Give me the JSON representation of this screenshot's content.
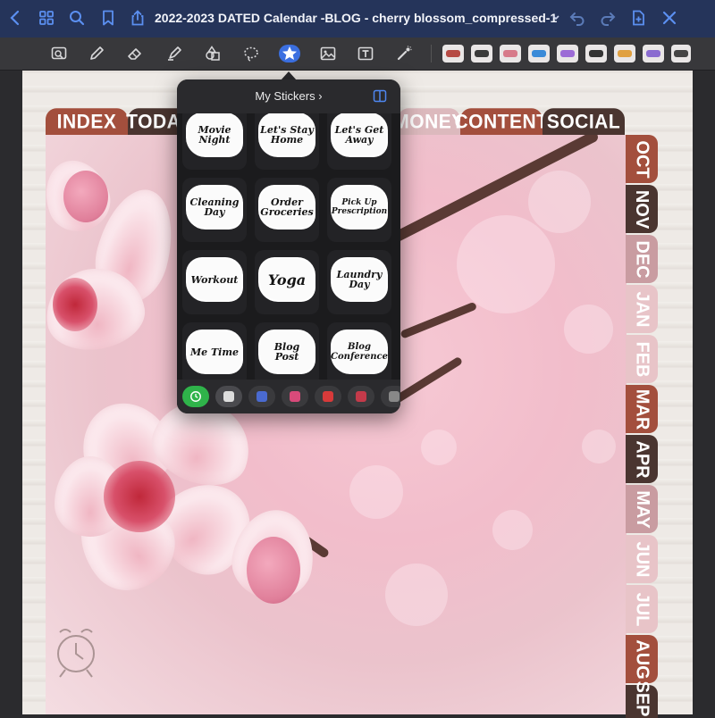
{
  "app": {
    "document_title": "2022-2023 DATED Calendar -BLOG - cherry blossom_compressed-1"
  },
  "titlebar": {
    "icons": [
      "back-icon",
      "grid-icon",
      "search-icon",
      "bookmark-icon",
      "share-icon",
      "undo-icon",
      "redo-icon",
      "add-page-icon",
      "close-icon"
    ]
  },
  "toolbar": {
    "tools": [
      "zoom-tool-icon",
      "pen-icon",
      "eraser-icon",
      "highlighter-icon",
      "shapes-icon",
      "lasso-icon",
      "sticker-icon",
      "image-icon",
      "text-icon",
      "laser-pointer-icon"
    ],
    "active_tool": "sticker-icon"
  },
  "planner": {
    "top_tabs": [
      {
        "label": "INDEX",
        "color": "#a34f3d"
      },
      {
        "label": "TODAY",
        "color": "#4a3530"
      },
      {
        "label": "MONEY",
        "color": "#dcb9bd"
      },
      {
        "label": "CONTENT",
        "color": "#a34f3d"
      },
      {
        "label": "SOCIAL",
        "color": "#4a3530"
      }
    ],
    "month_tabs": [
      {
        "label": "OCT",
        "color": "#a34f3d"
      },
      {
        "label": "NOV",
        "color": "#4a3530"
      },
      {
        "label": "DEC",
        "color": "#c99ca1"
      },
      {
        "label": "JAN",
        "color": "#e8c4c8"
      },
      {
        "label": "FEB",
        "color": "#e8c4c8"
      },
      {
        "label": "MAR",
        "color": "#a34f3d"
      },
      {
        "label": "APR",
        "color": "#4a3530"
      },
      {
        "label": "MAY",
        "color": "#c99ca1"
      },
      {
        "label": "JUN",
        "color": "#e8c4c8"
      },
      {
        "label": "JUL",
        "color": "#e8c4c8"
      },
      {
        "label": "AUG",
        "color": "#a34f3d"
      },
      {
        "label": "SEP",
        "color": "#4a3530"
      }
    ]
  },
  "stickers_panel": {
    "title": "My Stickers",
    "stickers": [
      {
        "line1": "Movie",
        "line2": "Night",
        "accent": "#e8623a"
      },
      {
        "line1": "Let's Stay",
        "line2": "Home",
        "accent": "#d77a8a"
      },
      {
        "line1": "Let's Get",
        "line2": "Away",
        "accent": "#3ab0d8"
      },
      {
        "line1": "Cleaning",
        "line2": "Day",
        "accent": "#9c6bd6"
      },
      {
        "line1": "Order",
        "line2": "Groceries",
        "accent": "#e0a040"
      },
      {
        "line1": "Pick Up",
        "line2": "Prescription",
        "accent": "#8a6bd0"
      },
      {
        "line1": "Workout",
        "line2": "",
        "accent": "#d8324a"
      },
      {
        "line1": "Yoga",
        "line2": "",
        "accent": "#333333"
      },
      {
        "line1": "Laundry",
        "line2": "Day",
        "accent": "#3a8ad8"
      },
      {
        "line1": "Me Time",
        "line2": "",
        "accent": "#e8b080"
      },
      {
        "line1": "Blog",
        "line2": "Post",
        "accent": "#3ab0b8"
      },
      {
        "line1": "Blog",
        "line2": "Conference",
        "accent": "#8a6bd0"
      }
    ],
    "categories": [
      "recent-icon",
      "sticker-pack-1",
      "sticker-pack-2",
      "sticker-pack-3",
      "sticker-pack-4",
      "sticker-pack-5",
      "sticker-pack-6"
    ]
  }
}
